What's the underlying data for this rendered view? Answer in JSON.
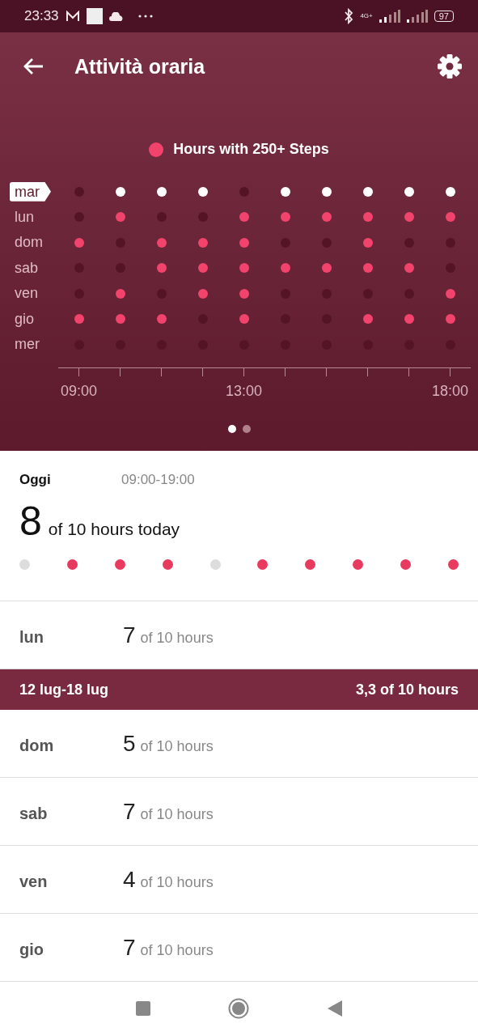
{
  "status_bar": {
    "time": "23:33",
    "network": "4G+",
    "battery": "97"
  },
  "header": {
    "title": "Attività oraria"
  },
  "legend": {
    "label": "Hours with 250+ Steps"
  },
  "grid": {
    "rows": [
      {
        "day": "mar",
        "selected": true,
        "active": [
          false,
          true,
          true,
          true,
          false,
          true,
          true,
          true,
          true,
          true
        ]
      },
      {
        "day": "lun",
        "selected": false,
        "active": [
          false,
          true,
          false,
          false,
          true,
          true,
          true,
          true,
          true,
          true
        ]
      },
      {
        "day": "dom",
        "selected": false,
        "active": [
          true,
          false,
          true,
          true,
          true,
          false,
          false,
          true,
          false,
          false
        ]
      },
      {
        "day": "sab",
        "selected": false,
        "active": [
          false,
          false,
          true,
          true,
          true,
          true,
          true,
          true,
          true,
          false
        ]
      },
      {
        "day": "ven",
        "selected": false,
        "active": [
          false,
          true,
          false,
          true,
          true,
          false,
          false,
          false,
          false,
          true
        ]
      },
      {
        "day": "gio",
        "selected": false,
        "active": [
          true,
          true,
          true,
          false,
          true,
          false,
          false,
          true,
          true,
          true
        ]
      },
      {
        "day": "mer",
        "selected": false,
        "active": [
          false,
          false,
          false,
          false,
          false,
          false,
          false,
          false,
          false,
          false
        ]
      }
    ],
    "axis_labels": [
      "09:00",
      "13:00",
      "18:00"
    ]
  },
  "pager": [
    {
      "selected": true
    },
    {
      "selected": false
    }
  ],
  "today": {
    "label": "Oggi",
    "range": "09:00-19:00",
    "count": "8",
    "suffix": "of 10 hours today",
    "hours": [
      false,
      true,
      true,
      true,
      false,
      true,
      true,
      true,
      true,
      true
    ]
  },
  "days_before": [
    {
      "day": "lun",
      "count": "7",
      "suffix": "of 10 hours"
    }
  ],
  "week": {
    "range": "12 lug-18 lug",
    "total": "3,3 of 10 hours"
  },
  "days": [
    {
      "day": "dom",
      "count": "5",
      "suffix": "of 10 hours"
    },
    {
      "day": "sab",
      "count": "7",
      "suffix": "of 10 hours"
    },
    {
      "day": "ven",
      "count": "4",
      "suffix": "of 10 hours"
    },
    {
      "day": "gio",
      "count": "7",
      "suffix": "of 10 hours"
    }
  ]
}
